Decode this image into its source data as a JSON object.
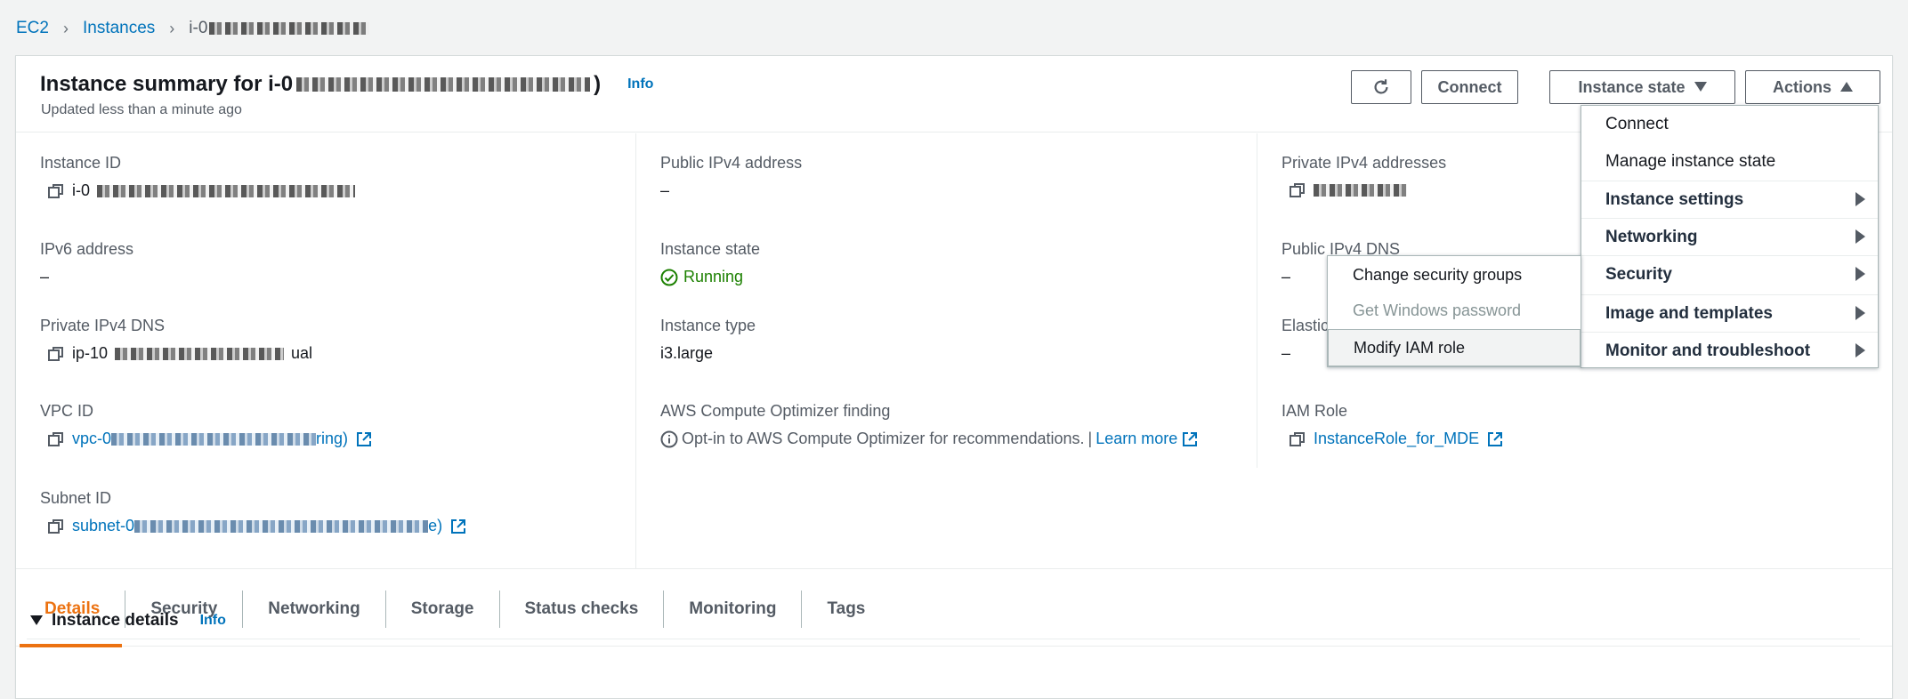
{
  "breadcrumb": {
    "root": "EC2",
    "middle": "Instances",
    "current": "i-0"
  },
  "header": {
    "title_prefix": "Instance summary for i-0",
    "title_suffix": ")",
    "info": "Info",
    "subtitle": "Updated less than a minute ago"
  },
  "buttons": {
    "connect": "Connect",
    "instance_state": "Instance state",
    "actions": "Actions"
  },
  "fields": {
    "instance_id": {
      "label": "Instance ID",
      "value": "i-0"
    },
    "ipv6": {
      "label": "IPv6 address",
      "value": "–"
    },
    "private_dns": {
      "label": "Private IPv4 DNS",
      "value_prefix": "ip-10",
      "value_suffix": "ual"
    },
    "vpc_id": {
      "label": "VPC ID",
      "value_prefix": "vpc-0",
      "value_suffix": "ring)"
    },
    "subnet_id": {
      "label": "Subnet ID",
      "value_prefix": "subnet-0",
      "value_suffix": "e)"
    },
    "public_ipv4": {
      "label": "Public IPv4 address",
      "value": "–"
    },
    "instance_state": {
      "label": "Instance state",
      "value": "Running"
    },
    "instance_type": {
      "label": "Instance type",
      "value": "i3.large"
    },
    "optimizer": {
      "label": "AWS Compute Optimizer finding",
      "text": "Opt-in to AWS Compute Optimizer for recommendations.",
      "sep": "|",
      "link": "Learn more"
    },
    "private_ipv4": {
      "label": "Private IPv4 addresses"
    },
    "public_dns": {
      "label": "Public IPv4 DNS",
      "value": "–"
    },
    "elastic": {
      "label": "Elastic",
      "value": "–"
    },
    "iam_role": {
      "label": "IAM Role",
      "value": "InstanceRole_for_MDE"
    }
  },
  "tabs": [
    "Details",
    "Security",
    "Networking",
    "Storage",
    "Status checks",
    "Monitoring",
    "Tags"
  ],
  "details_section": {
    "title": "Instance details",
    "info": "Info"
  },
  "actions_menu": [
    "Connect",
    "Manage instance state",
    "Instance settings",
    "Networking",
    "Security",
    "Image and templates",
    "Monitor and troubleshoot"
  ],
  "security_submenu": [
    "Change security groups",
    "Get Windows password",
    "Modify IAM role"
  ],
  "colors": {
    "link": "#0073bb",
    "accent": "#ec7211",
    "running": "#1d8102"
  }
}
